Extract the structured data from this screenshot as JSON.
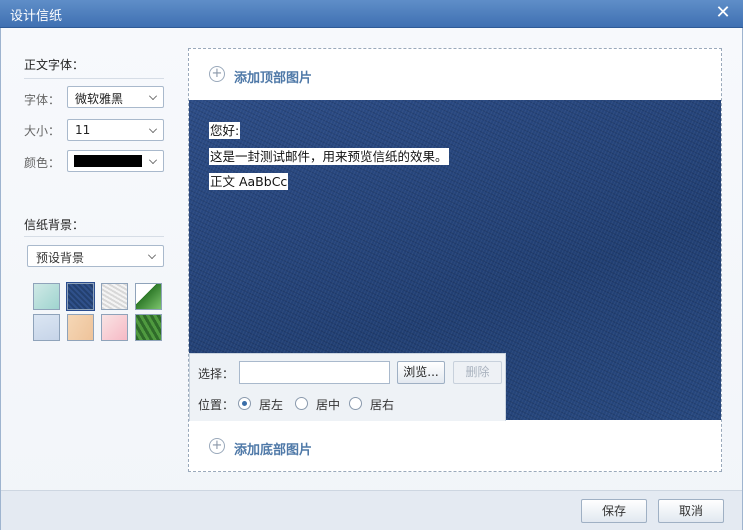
{
  "window": {
    "title": "设计信纸",
    "close_glyph": "✕"
  },
  "body_font": {
    "section_title": "正文字体：",
    "font_label": "字体：",
    "font_value": "微软雅黑",
    "size_label": "大小：",
    "size_value": "11",
    "color_label": "颜色：",
    "color_value": "#000000"
  },
  "background": {
    "section_title": "信纸背景：",
    "preset_value": "预设背景",
    "thumbnails": [
      "mint-pattern",
      "denim",
      "gray-texture",
      "leaf",
      "blue-sketch",
      "wood",
      "pink-flower",
      "grass"
    ]
  },
  "preview": {
    "add_top": "添加顶部图片",
    "add_bottom": "添加底部图片",
    "plus_glyph": "+",
    "lines": [
      "您好:",
      "这是一封测试邮件，用来预览信纸的效果。",
      "正文 AaBbCc"
    ]
  },
  "picker": {
    "select_label": "选择：",
    "browse_label": "浏览...",
    "delete_label": "删除",
    "position_label": "位置：",
    "options": [
      "居左",
      "居中",
      "居右"
    ],
    "selected": "居左"
  },
  "footer": {
    "save_label": "保存",
    "cancel_label": "取消"
  }
}
